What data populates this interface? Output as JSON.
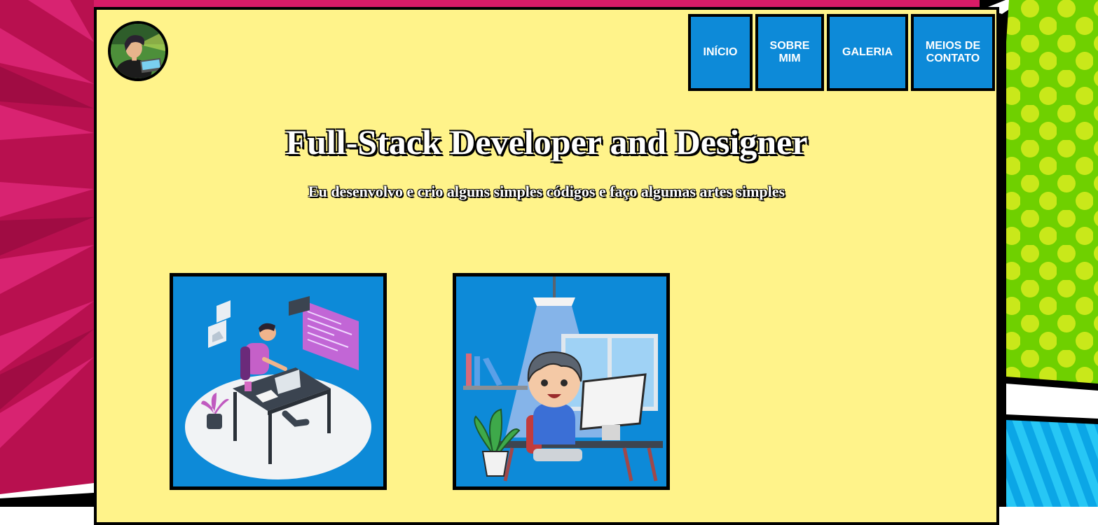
{
  "nav": {
    "items": [
      {
        "label": "INÍCIO"
      },
      {
        "label": "SOBRE MIM"
      },
      {
        "label": "GALERIA"
      },
      {
        "label": "MEIOS DE CONTATO"
      }
    ]
  },
  "hero": {
    "title": "Full-Stack Developer and Designer",
    "subtitle": "Eu desenvolvo e crio alguns simples códigos e faço algumas artes simples"
  },
  "gallery": {
    "cards": [
      {
        "icon": "developer-at-desk-illustration"
      },
      {
        "icon": "cartoon-programmer-at-computer-illustration"
      }
    ]
  },
  "colors": {
    "panel": "#fff38a",
    "nav_button": "#0d8ad8",
    "border": "#000000",
    "bg_magenta": "#c4105e",
    "bg_green": "#6fd000",
    "bg_cyan": "#1ec2f0"
  }
}
